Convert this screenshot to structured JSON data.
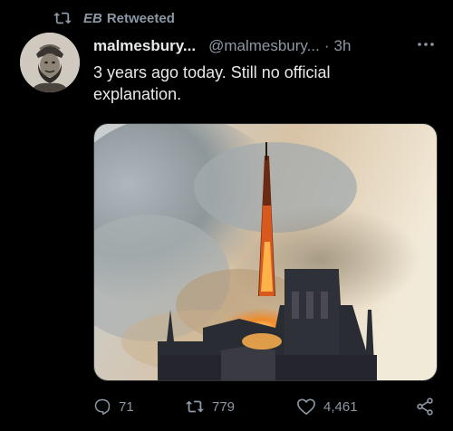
{
  "retweet_context": {
    "name": "EB",
    "label": "Retweeted",
    "icon": "retweet-icon"
  },
  "tweet": {
    "display_name": "malmesbury...",
    "handle": "@malmesbury...",
    "separator": "·",
    "time": "3h",
    "text": "3 years ago today. Still no official explanation.",
    "avatar": "avatar-portrait",
    "more_icon": "more-icon",
    "media": "cathedral-spire-fire-photo"
  },
  "actions": {
    "reply": {
      "icon": "reply-icon",
      "count": "71"
    },
    "retweet": {
      "icon": "retweet-icon",
      "count": "779"
    },
    "like": {
      "icon": "heart-icon",
      "count": "4,461"
    },
    "share": {
      "icon": "share-icon"
    }
  },
  "colors": {
    "background": "#000000",
    "primary_text": "#e7e9ea",
    "secondary_text": "#8b98a5"
  }
}
